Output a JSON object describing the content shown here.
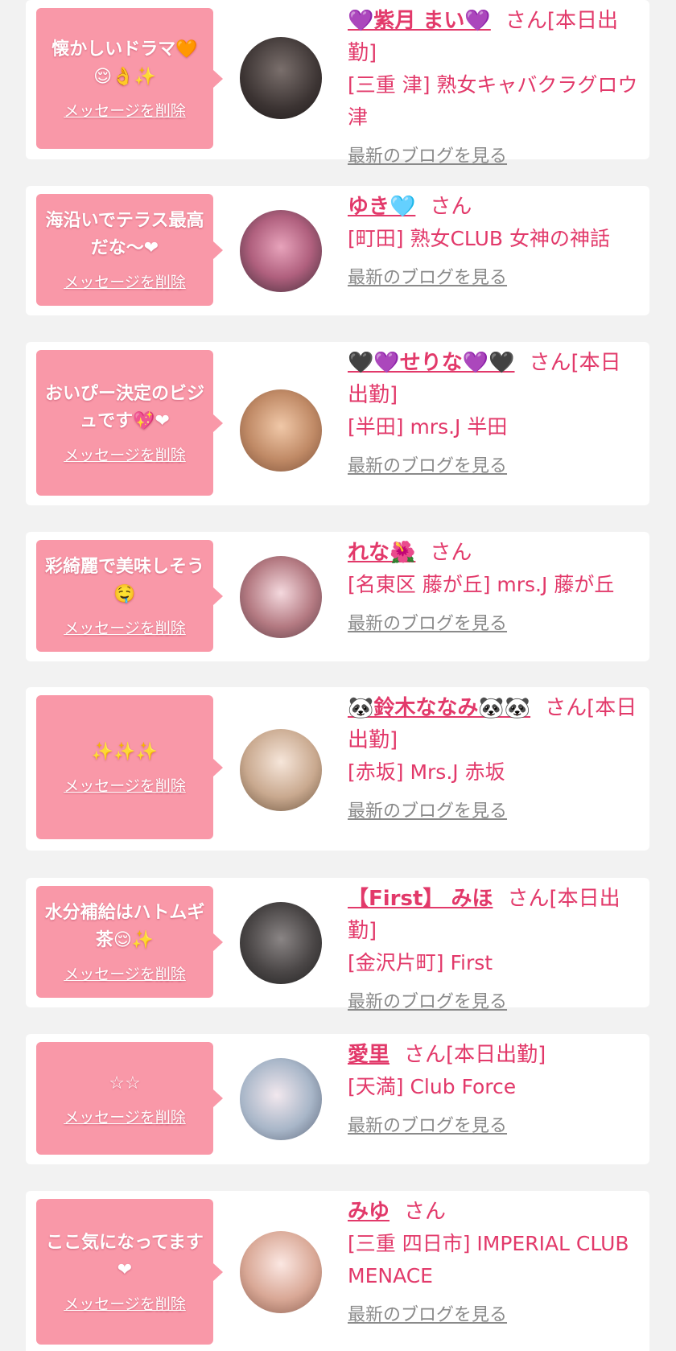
{
  "delete_label": "メッセージを削除",
  "blog_label": "最新のブログを見る",
  "cards": [
    {
      "message": "懐かしいドラマ🧡😌👌✨",
      "name": "💜紫月 まい💜",
      "suffix": "さん[本日出勤]",
      "shop": "[三重 津] 熟女キャバクラグロウ津",
      "avatar_icon": "avatar-photo"
    },
    {
      "message": "海沿いでテラス最高だな〜❤",
      "name": "ゆき🩵",
      "suffix": "さん",
      "shop": "[町田] 熟女CLUB 女神の神話",
      "avatar_icon": "avatar-photo"
    },
    {
      "message": "おいぴー決定のビジュです💖❤",
      "name": "🖤💜せりな💜🖤",
      "suffix": "さん[本日出勤]",
      "shop": "[半田] mrs.J 半田",
      "avatar_icon": "avatar-photo"
    },
    {
      "message": "彩綺麗で美味しそう🤤",
      "name": "れな🌺",
      "suffix": "さん",
      "shop": "[名東区 藤が丘] mrs.J 藤が丘",
      "avatar_icon": "avatar-photo"
    },
    {
      "message": "✨✨✨",
      "name": "🐼鈴木ななみ🐼🐼",
      "suffix": "さん[本日出勤]",
      "shop": "[赤坂] Mrs.J 赤坂",
      "avatar_icon": "avatar-photo"
    },
    {
      "message": "水分補給はハトムギ茶😌✨",
      "name": "【First】 みほ",
      "suffix": "さん[本日出勤]",
      "shop": "[金沢片町] First",
      "avatar_icon": "avatar-photo"
    },
    {
      "message": "☆☆",
      "name": "愛里",
      "suffix": "さん[本日出勤]",
      "shop": "[天満] Club Force",
      "avatar_icon": "avatar-photo"
    },
    {
      "message": "ここ気になってます❤",
      "name": "みゆ",
      "suffix": "さん",
      "shop": "[三重 四日市] IMPERIAL CLUB MENACE",
      "avatar_icon": "avatar-photo"
    }
  ],
  "colors": {
    "background": "#f2f2f2",
    "card": "#ffffff",
    "bubble": "#f998a8",
    "accent": "#e2396a",
    "link_gray": "#8a8a8a"
  }
}
